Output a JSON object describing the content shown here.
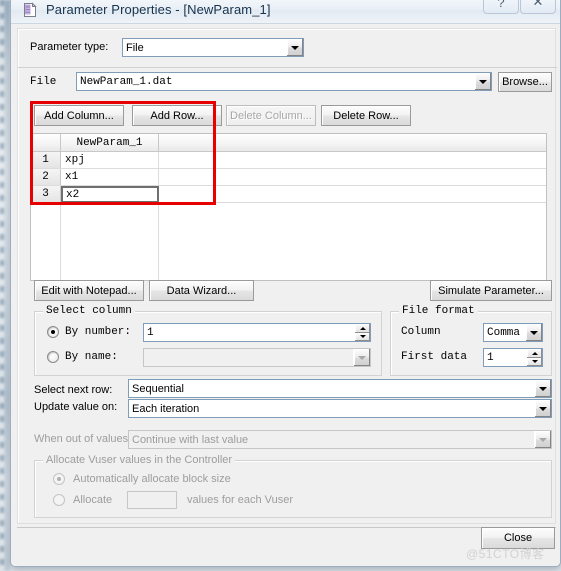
{
  "window": {
    "title": "Parameter Properties - [NewParam_1]",
    "icon": "parameter-file-icon",
    "help_button": "?",
    "close_button": "✕"
  },
  "parameter_type": {
    "label": "Parameter type:",
    "value": "File"
  },
  "file": {
    "label": "File",
    "value": "NewParam_1.dat",
    "browse_label": "Browse..."
  },
  "table_toolbar": {
    "add_column": "Add Column...",
    "add_row": "Add Row...",
    "delete_column": "Delete Column...",
    "delete_row": "Delete Row..."
  },
  "table": {
    "columns": [
      "NewParam_1"
    ],
    "rows": [
      {
        "num": "1",
        "values": [
          "xpj"
        ]
      },
      {
        "num": "2",
        "values": [
          "x1"
        ]
      },
      {
        "num": "3",
        "values": [
          "x2"
        ]
      }
    ],
    "selected_row": "3",
    "selected_value": "x2"
  },
  "actions": {
    "edit_with_notepad": "Edit with Notepad...",
    "data_wizard": "Data Wizard...",
    "simulate_parameter": "Simulate Parameter..."
  },
  "select_column": {
    "title": "Select column",
    "by_number_label": "By number:",
    "by_number_value": "1",
    "by_number_selected": true,
    "by_name_label": "By name:",
    "by_name_value": "",
    "by_name_selected": false
  },
  "file_format": {
    "title": "File format",
    "column_label": "Column",
    "column_value": "Comma",
    "first_data_label": "First data",
    "first_data_value": "1"
  },
  "row_settings": {
    "select_next_row_label": "Select next row:",
    "select_next_row_value": "Sequential",
    "update_value_on_label": "Update value on:",
    "update_value_on_value": "Each iteration",
    "when_out_of_values_label": "When out of values:",
    "when_out_of_values_value": "Continue with last value"
  },
  "allocate": {
    "title": "Allocate Vuser values in the Controller",
    "auto_label": "Automatically allocate block size",
    "auto_selected": true,
    "manual_label": "Allocate",
    "manual_value": "",
    "manual_suffix": "values for each Vuser",
    "manual_selected": false
  },
  "footer": {
    "close_label": "Close"
  },
  "watermark": {
    "text": "@51CTO博客"
  },
  "colors": {
    "annotation": "#e60000",
    "dialog_face": "#f0f0f0",
    "field_border": "#7f9db9"
  }
}
